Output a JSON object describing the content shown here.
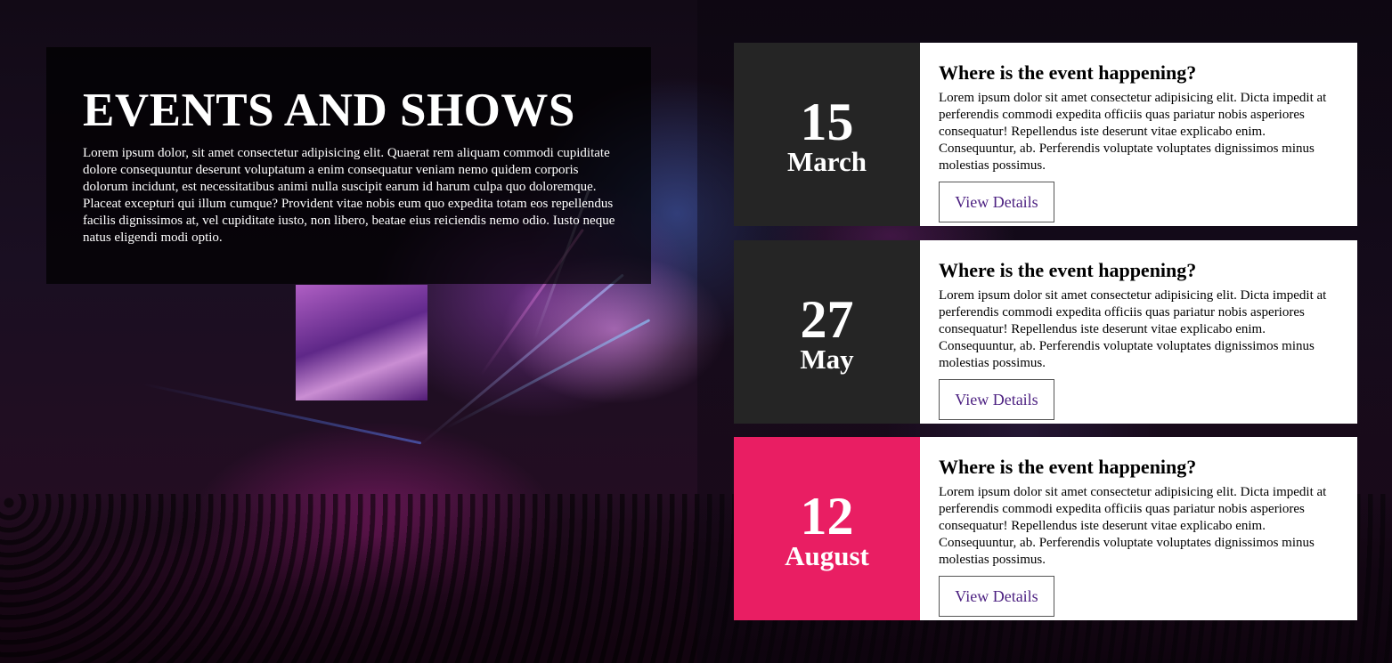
{
  "intro": {
    "title": "EVENTS AND SHOWS",
    "text": "Lorem ipsum dolor, sit amet consectetur adipisicing elit. Quaerat rem aliquam commodi cupiditate dolore consequuntur deserunt voluptatum a enim consequatur veniam nemo quidem corporis dolorum incidunt, est necessitatibus animi nulla suscipit earum id harum culpa quo doloremque. Placeat excepturi qui illum cumque? Provident vitae nobis eum quo expedita totam eos repellendus facilis dignissimos at, vel cupiditate iusto, non libero, beatae eius reiciendis nemo odio. Iusto neque natus eligendi modi optio."
  },
  "events": [
    {
      "day": "15",
      "month": "March",
      "heading": "Where is the event happening?",
      "text": "Lorem ipsum dolor sit amet consectetur adipisicing elit. Dicta impedit at perferendis commodi expedita officiis quas pariatur nobis asperiores consequatur! Repellendus iste deserunt vitae explicabo enim. Consequuntur, ab. Perferendis voluptate voluptates dignissimos minus molestias possimus.",
      "button": "View Details"
    },
    {
      "day": "27",
      "month": "May",
      "heading": "Where is the event happening?",
      "text": "Lorem ipsum dolor sit amet consectetur adipisicing elit. Dicta impedit at perferendis commodi expedita officiis quas pariatur nobis asperiores consequatur! Repellendus iste deserunt vitae explicabo enim. Consequuntur, ab. Perferendis voluptate voluptates dignissimos minus molestias possimus.",
      "button": "View Details"
    },
    {
      "day": "12",
      "month": "August",
      "heading": "Where is the event happening?",
      "text": "Lorem ipsum dolor sit amet consectetur adipisicing elit. Dicta impedit at perferendis commodi expedita officiis quas pariatur nobis asperiores consequatur! Repellendus iste deserunt vitae explicabo enim. Consequuntur, ab. Perferendis voluptate voluptates dignissimos minus molestias possimus.",
      "button": "View Details"
    }
  ],
  "colors": {
    "date_dark": "#252525",
    "date_accent": "#e91e63",
    "button_text": "#4b1f80"
  }
}
